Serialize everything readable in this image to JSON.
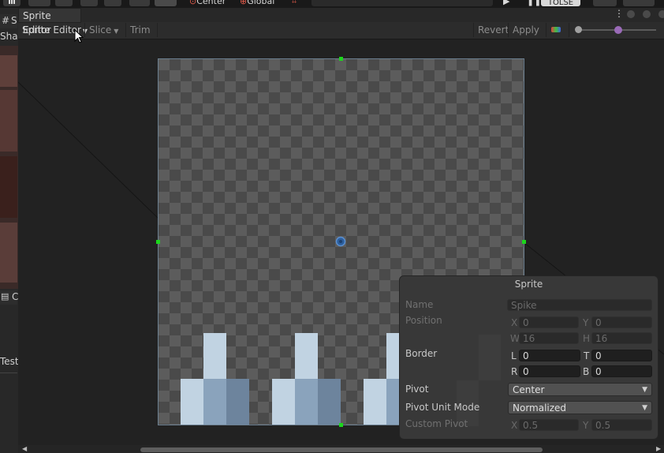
{
  "topbar": {
    "pivot_mode": "Center",
    "pivot_rotation": "Global",
    "layers_label": "TOLSE"
  },
  "tooltip": {
    "text": "Sprite Editor"
  },
  "left_panel": {
    "tab1_label": "S",
    "item1_label": "Shac",
    "tab2_label": "C",
    "item2_label": "Test"
  },
  "editor_toolbar": {
    "mode_dropdown": "Sprite Editor",
    "slice_label": "Slice",
    "trim_label": "Trim",
    "revert_label": "Revert",
    "apply_label": "Apply"
  },
  "sprite_panel": {
    "title": "Sprite",
    "name_label": "Name",
    "name_value": "Spike",
    "position_label": "Position",
    "pos_x_label": "X",
    "pos_x_value": "0",
    "pos_y_label": "Y",
    "pos_y_value": "0",
    "pos_w_label": "W",
    "pos_w_value": "16",
    "pos_h_label": "H",
    "pos_h_value": "16",
    "border_label": "Border",
    "border_l_label": "L",
    "border_l_value": "0",
    "border_t_label": "T",
    "border_t_value": "0",
    "border_r_label": "R",
    "border_r_value": "0",
    "border_b_label": "B",
    "border_b_value": "0",
    "pivot_label": "Pivot",
    "pivot_value": "Center",
    "pivot_unit_label": "Pivot Unit Mode",
    "pivot_unit_value": "Normalized",
    "custom_pivot_label": "Custom Pivot",
    "custom_x_label": "X",
    "custom_x_value": "0.5",
    "custom_y_label": "Y",
    "custom_y_value": "0.5"
  },
  "colors": {
    "handle": "#1cd61c",
    "spike_light": "#c1d3e2",
    "spike_mid": "#8aa3bc",
    "spike_dark": "#6d849d"
  }
}
